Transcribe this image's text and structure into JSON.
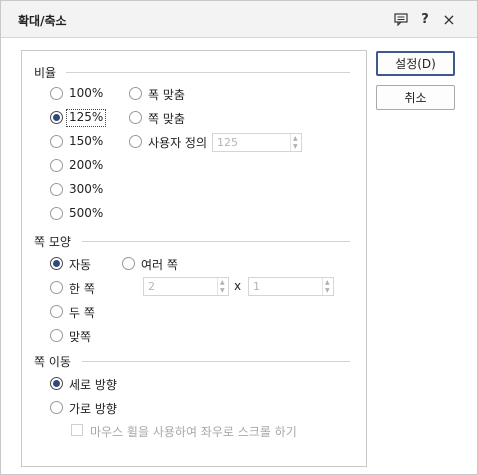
{
  "window": {
    "title": "확대/축소",
    "help_glyph": "?",
    "close_glyph": "×"
  },
  "buttons": {
    "ok_label": "설정(D)",
    "cancel_label": "취소"
  },
  "ratio": {
    "heading": "비율",
    "options": [
      "100%",
      "125%",
      "150%",
      "200%",
      "300%",
      "500%"
    ],
    "selected": "125%",
    "fit_options": [
      "폭 맞춤",
      "쪽 맞춤",
      "사용자 정의"
    ],
    "custom_value": "125"
  },
  "page_shape": {
    "heading": "쪽 모양",
    "options": [
      "자동",
      "한 쪽",
      "두 쪽",
      "맞쪽"
    ],
    "multi_label": "여러 쪽",
    "selected": "자동",
    "multi_cols": "2",
    "times": "x",
    "multi_rows": "1"
  },
  "page_move": {
    "heading": "쪽 이동",
    "options": [
      "세로 방향",
      "가로 방향"
    ],
    "selected": "세로 방향",
    "wheel_checkbox_label": "마우스 휠을 사용하여 좌우로 스크롤 하기"
  }
}
